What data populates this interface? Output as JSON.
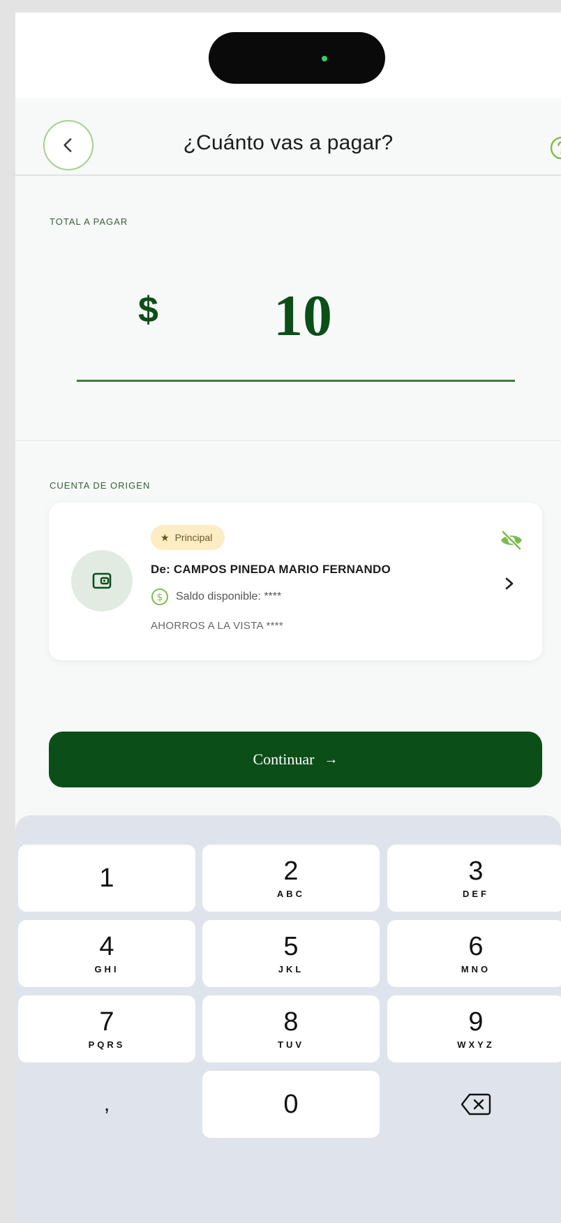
{
  "header": {
    "title": "¿Cuánto vas a pagar?"
  },
  "amount": {
    "label": "TOTAL A PAGAR",
    "currency": "$",
    "value": "10"
  },
  "origin": {
    "label": "CUENTA DE ORIGEN",
    "badge": "Principal",
    "holder": "De: CAMPOS PINEDA MARIO FERNANDO",
    "balance": "Saldo disponible: ****",
    "account_type": "AHORROS A LA VISTA ****"
  },
  "continue_button": {
    "label": "Continuar",
    "arrow": "→"
  },
  "keypad": {
    "keys": [
      {
        "num": "1",
        "letters": ""
      },
      {
        "num": "2",
        "letters": "ABC"
      },
      {
        "num": "3",
        "letters": "DEF"
      },
      {
        "num": "4",
        "letters": "GHI"
      },
      {
        "num": "5",
        "letters": "JKL"
      },
      {
        "num": "6",
        "letters": "MNO"
      },
      {
        "num": "7",
        "letters": "PQRS"
      },
      {
        "num": "8",
        "letters": "TUV"
      },
      {
        "num": "9",
        "letters": "WXYZ"
      },
      {
        "num": "0",
        "letters": ""
      }
    ],
    "comma": ","
  },
  "colors": {
    "primary": "#0c4e18",
    "accent": "#a9cf8f",
    "badge_bg": "#fdecc4",
    "keypad_bg": "#dfe4ec"
  }
}
